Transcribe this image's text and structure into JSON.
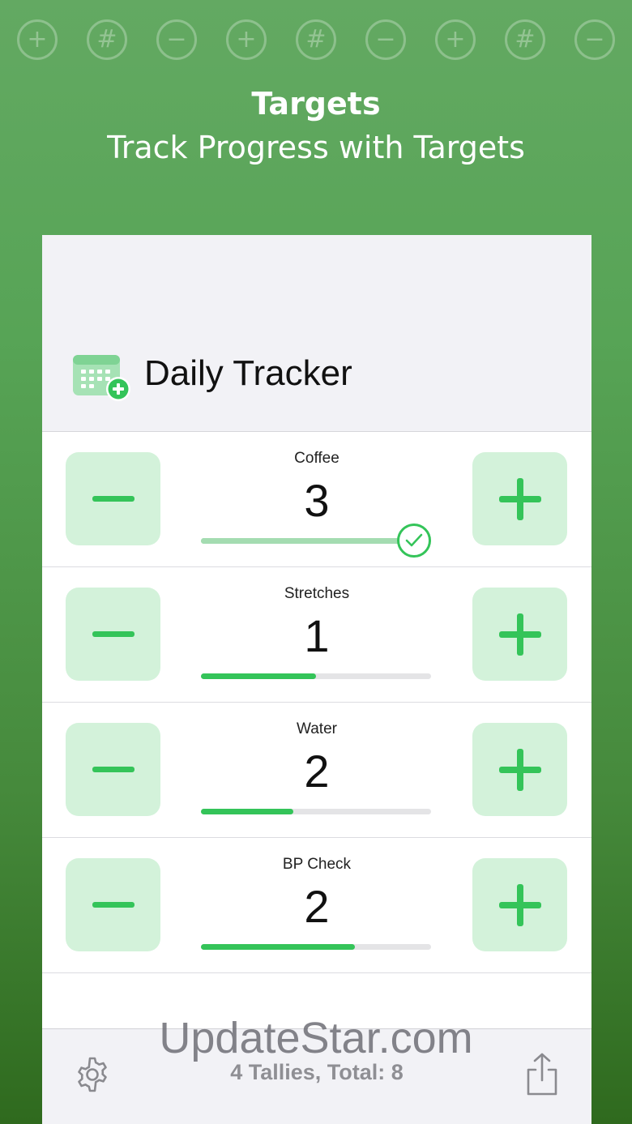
{
  "banner": {
    "headline": "Targets",
    "subheadline": "Track Progress with Targets",
    "icons": [
      {
        "icon": "plus-circle-icon",
        "glyph": "+"
      },
      {
        "icon": "hash-circle-icon",
        "glyph": "#"
      },
      {
        "icon": "minus-circle-icon",
        "glyph": "−"
      },
      {
        "icon": "plus-circle-icon",
        "glyph": "+"
      },
      {
        "icon": "hash-circle-icon",
        "glyph": "#"
      },
      {
        "icon": "minus-circle-icon",
        "glyph": "−"
      },
      {
        "icon": "plus-circle-icon",
        "glyph": "+"
      },
      {
        "icon": "hash-circle-icon",
        "glyph": "#"
      },
      {
        "icon": "minus-circle-icon",
        "glyph": "−"
      }
    ]
  },
  "app": {
    "title": "Daily Tracker",
    "icon": "calendar-add-icon"
  },
  "tallies": [
    {
      "name": "Coffee",
      "count": "3",
      "progress": 1.0,
      "target_met": true
    },
    {
      "name": "Stretches",
      "count": "1",
      "progress": 0.5,
      "target_met": false
    },
    {
      "name": "Water",
      "count": "2",
      "progress": 0.4,
      "target_met": false
    },
    {
      "name": "BP Check",
      "count": "2",
      "progress": 0.67,
      "target_met": false
    }
  ],
  "toolbar": {
    "status": "4 Tallies, Total: 8",
    "settings_icon": "gear-icon",
    "share_icon": "share-icon"
  },
  "watermark": "UpdateStar.com",
  "colors": {
    "accent": "#34c459",
    "button_bg": "#d3f2da",
    "completed_track": "#a4dcb1"
  }
}
